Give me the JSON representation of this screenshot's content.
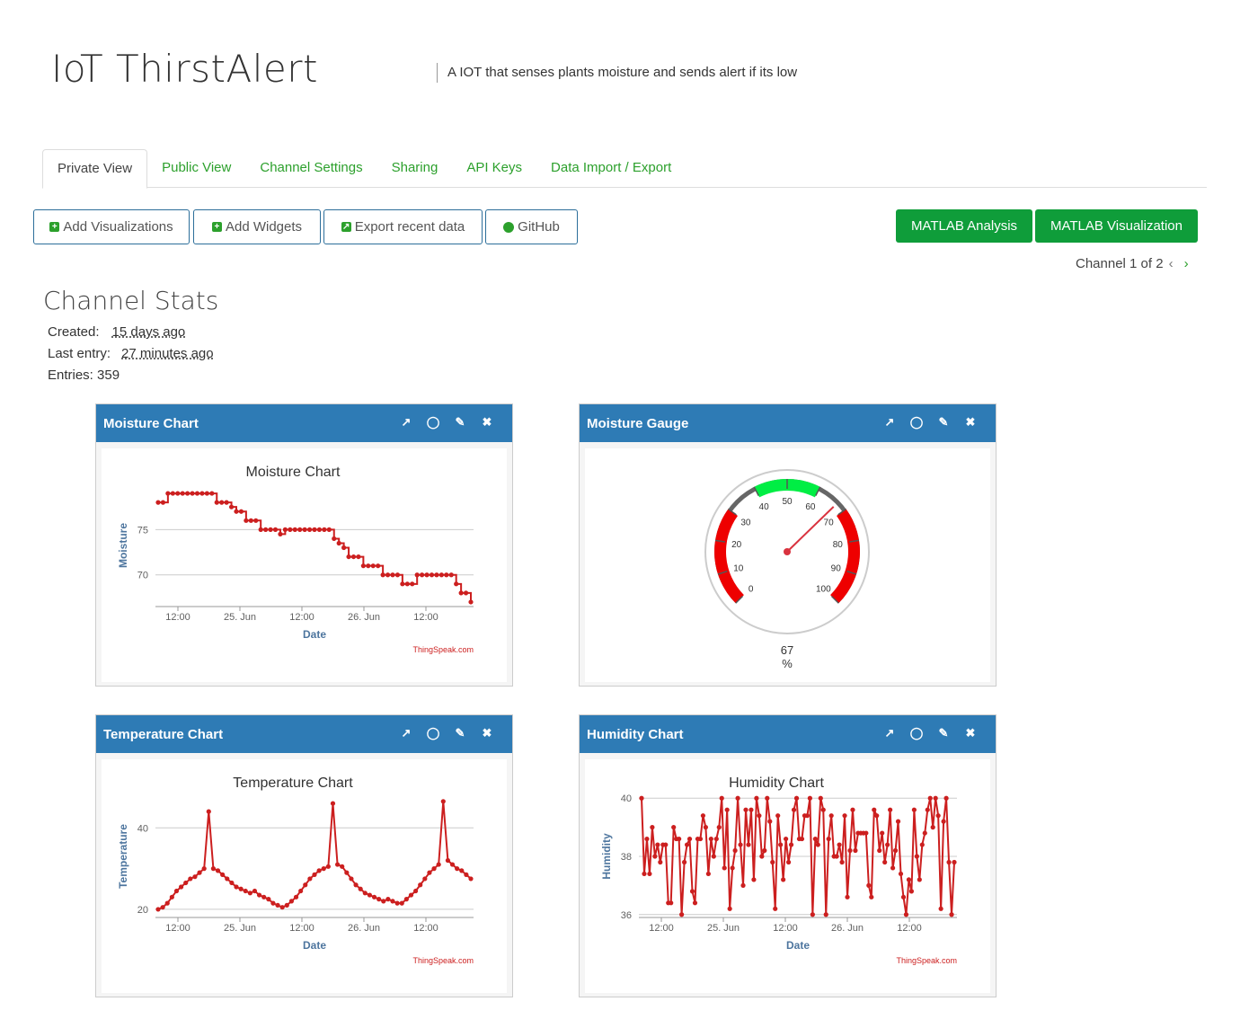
{
  "header": {
    "title": "IoT ThirstAlert",
    "description": "A IOT that senses plants moisture and sends alert if its low"
  },
  "tabs": [
    {
      "label": "Private View",
      "active": true
    },
    {
      "label": "Public View"
    },
    {
      "label": "Channel Settings"
    },
    {
      "label": "Sharing"
    },
    {
      "label": "API Keys"
    },
    {
      "label": "Data Import / Export"
    }
  ],
  "toolbar": {
    "add_visualizations": "Add Visualizations",
    "add_widgets": "Add Widgets",
    "export_recent": "Export recent data",
    "github": "GitHub",
    "matlab_analysis": "MATLAB Analysis",
    "matlab_visualization": "MATLAB Visualization"
  },
  "channel_nav": {
    "label": "Channel 1 of 2"
  },
  "stats": {
    "heading": "Channel Stats",
    "created_label": "Created:",
    "created_value": "15 days ago",
    "last_entry_label": "Last entry:",
    "last_entry_value": "27 minutes ago",
    "entries_label": "Entries: 359"
  },
  "widgets": {
    "moisture_chart": {
      "title": "Moisture Chart"
    },
    "moisture_gauge": {
      "title": "Moisture Gauge",
      "value": "67",
      "unit": "%",
      "ticks": [
        "0",
        "10",
        "20",
        "30",
        "40",
        "50",
        "60",
        "70",
        "80",
        "90",
        "100"
      ]
    },
    "temperature_chart": {
      "title": "Temperature Chart"
    },
    "humidity_chart": {
      "title": "Humidity Chart"
    }
  },
  "credit": "ThingSpeak.com",
  "colors": {
    "accent": "#2ca02c",
    "header": "#2e7bb5",
    "series": "#cc1f1f",
    "matlab": "#0f9d3a"
  },
  "chart_data": [
    {
      "type": "line",
      "title": "Moisture Chart",
      "xlabel": "Date",
      "ylabel": "Moisture",
      "x_ticks": [
        "12:00",
        "25. Jun",
        "12:00",
        "26. Jun",
        "12:00"
      ],
      "y_ticks": [
        70,
        75
      ],
      "ylim": [
        66.5,
        80
      ],
      "values": [
        78,
        78,
        79,
        79,
        79,
        79,
        79,
        79,
        79,
        79,
        79,
        79,
        78,
        78,
        78,
        77.5,
        77,
        77,
        76,
        76,
        76,
        75,
        75,
        75,
        75,
        74.5,
        75,
        75,
        75,
        75,
        75,
        75,
        75,
        75,
        75,
        75,
        74,
        73.5,
        73,
        72,
        72,
        72,
        71,
        71,
        71,
        71,
        70,
        70,
        70,
        70,
        69,
        69,
        69,
        70,
        70,
        70,
        70,
        70,
        70,
        70,
        70,
        69,
        68,
        68,
        67
      ]
    },
    {
      "type": "gauge",
      "title": "Moisture Gauge",
      "value": 67,
      "min": 0,
      "max": 100,
      "unit": "%"
    },
    {
      "type": "line",
      "title": "Temperature Chart",
      "xlabel": "Date",
      "ylabel": "Temperature",
      "x_ticks": [
        "12:00",
        "25. Jun",
        "12:00",
        "26. Jun",
        "12:00"
      ],
      "y_ticks": [
        20,
        40
      ],
      "ylim": [
        18,
        48
      ],
      "values": [
        20,
        20.5,
        21.5,
        23,
        24.5,
        25.5,
        26.5,
        27.5,
        28,
        29,
        30,
        44,
        30,
        29.5,
        28.5,
        27.5,
        26.5,
        25.5,
        25,
        24.5,
        24,
        24.5,
        23.5,
        23,
        22.5,
        21.5,
        21,
        20.5,
        21,
        22,
        23,
        24.5,
        26,
        27.5,
        28.5,
        29.5,
        30,
        30.5,
        46,
        31,
        30.5,
        29,
        27.5,
        26,
        25,
        24,
        23.5,
        23,
        22.5,
        22,
        22.5,
        22,
        21.5,
        21.5,
        22.5,
        23.5,
        24.5,
        26,
        27.5,
        29,
        30,
        31,
        46.5,
        32,
        31,
        30,
        29.5,
        28.5,
        27.5
      ]
    },
    {
      "type": "line",
      "title": "Humidity Chart",
      "xlabel": "Date",
      "ylabel": "Humidity",
      "x_ticks": [
        "12:00",
        "25. Jun",
        "12:00",
        "26. Jun",
        "12:00"
      ],
      "y_ticks": [
        36,
        38,
        40
      ],
      "ylim": [
        35.9,
        40.1
      ],
      "values": [
        40,
        37.4,
        38.6,
        37.4,
        39,
        38,
        38.4,
        37.8,
        38.4,
        38.4,
        36.4,
        36.4,
        39,
        38.6,
        38.6,
        36,
        37.8,
        38.4,
        38.6,
        36.8,
        36.4,
        38.6,
        38.6,
        39.4,
        39,
        37.4,
        38.6,
        38,
        38.6,
        39,
        40,
        37.6,
        39.6,
        36.2,
        37.6,
        38.2,
        40,
        38.4,
        37,
        39.6,
        38.4,
        39.6,
        37.2,
        40,
        39.4,
        38,
        38.2,
        40,
        39.2,
        37.8,
        36.2,
        39.4,
        38.4,
        37.2,
        38.6,
        37.8,
        38.4,
        39.6,
        40,
        38.6,
        38.6,
        39.4,
        39.4,
        40,
        36,
        38.6,
        38.4,
        40,
        39.6,
        36,
        38.6,
        39.4,
        38,
        38,
        38.4,
        37.8,
        39.4,
        36.6,
        38.2,
        39.6,
        38.2,
        38.8,
        38.8,
        38.8,
        38.8,
        37,
        36.6,
        39.6,
        39.4,
        38.2,
        38.8,
        37.8,
        38.4,
        39.6,
        37.6,
        38.2,
        39.2,
        37.4,
        36.6,
        36,
        37.2,
        36.8,
        39.6,
        38,
        37.2,
        38.4,
        38.8,
        39.6,
        40,
        39,
        40,
        39.4,
        36.2,
        39.2,
        40,
        37.8,
        36,
        37.8
      ]
    }
  ]
}
